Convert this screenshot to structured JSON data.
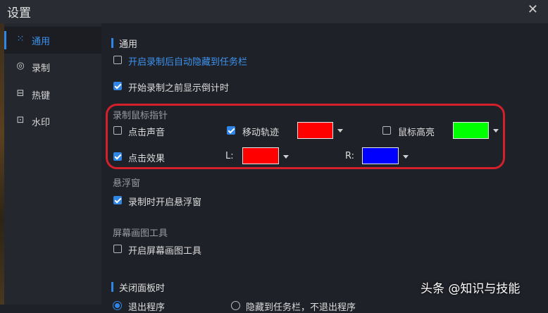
{
  "window": {
    "title": "设置",
    "close_glyph": "✕"
  },
  "sidebar": {
    "items": [
      {
        "label": "通用",
        "icon": "grid-icon",
        "glyph": "⁙",
        "active": true
      },
      {
        "label": "录制",
        "icon": "record-icon",
        "glyph": "◎",
        "active": false
      },
      {
        "label": "热键",
        "icon": "keyboard-icon",
        "glyph": "⊟",
        "active": false
      },
      {
        "label": "水印",
        "icon": "watermark-icon",
        "glyph": "⊡",
        "active": false
      }
    ]
  },
  "general": {
    "heading": "通用",
    "hide_taskbar_label": "开启录制后自动隐藏到任务栏",
    "hide_taskbar_checked": false,
    "countdown_label": "开始录制之前显示倒计时",
    "countdown_checked": true
  },
  "mouse": {
    "heading": "录制鼠标指针",
    "click_sound_label": "点击声音",
    "click_sound_checked": false,
    "move_track_label": "移动轨迹",
    "move_track_checked": true,
    "move_track_color": "#ff0000",
    "highlight_label": "鼠标高亮",
    "highlight_checked": false,
    "highlight_color": "#00ff00",
    "click_effect_label": "点击效果",
    "click_effect_checked": true,
    "left_label": "L:",
    "left_color": "#ff0000",
    "right_label": "R:",
    "right_color": "#0000ff"
  },
  "float": {
    "heading": "悬浮窗",
    "open_float_label": "录制时开启悬浮窗",
    "open_float_checked": true
  },
  "draw": {
    "heading": "屏幕画图工具",
    "open_draw_label": "开启屏幕画图工具",
    "open_draw_checked": false
  },
  "close_panel": {
    "heading": "关闭面板时",
    "option1": "退出程序",
    "option2": "隐藏到任务栏，不退出程序"
  },
  "watermark_text": "头条 @知识与技能"
}
